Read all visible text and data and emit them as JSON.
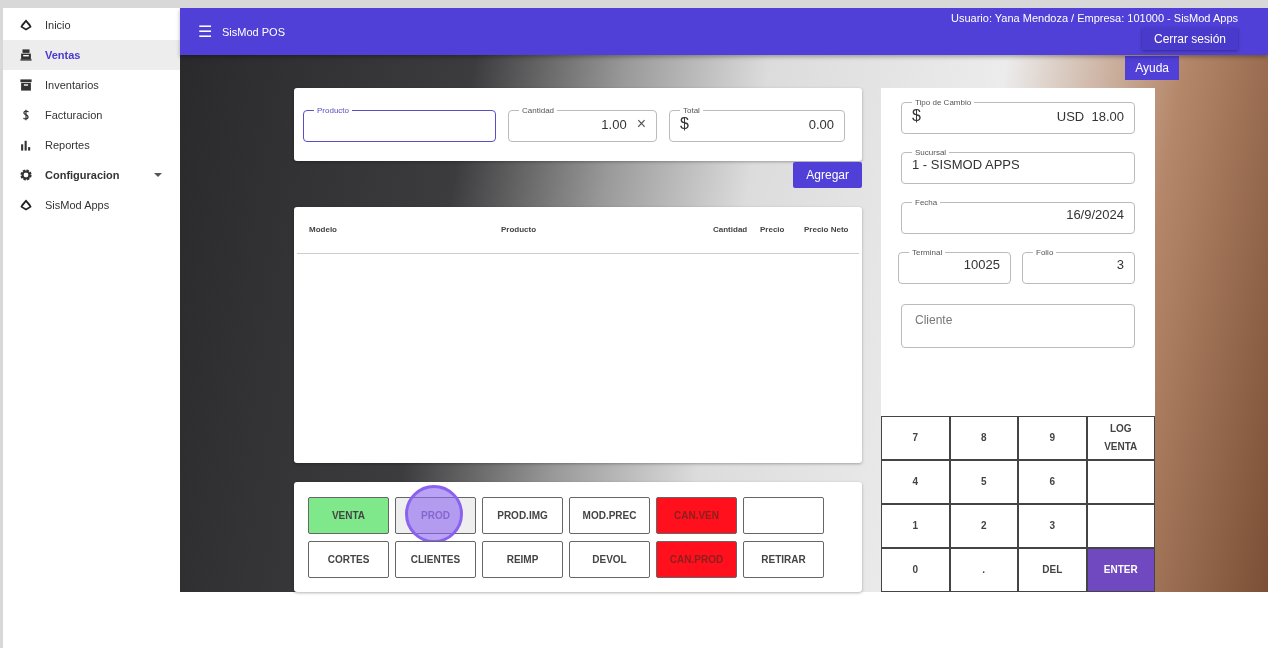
{
  "sidebar": {
    "items": [
      {
        "label": "Inicio",
        "selected": false,
        "expandable": false
      },
      {
        "label": "Ventas",
        "selected": true,
        "expandable": false
      },
      {
        "label": "Inventarios",
        "selected": false,
        "expandable": false
      },
      {
        "label": "Facturacion",
        "selected": false,
        "expandable": false
      },
      {
        "label": "Reportes",
        "selected": false,
        "expandable": false
      },
      {
        "label": "Configuracion",
        "selected": false,
        "expandable": true
      },
      {
        "label": "SisMod Apps",
        "selected": false,
        "expandable": false
      }
    ]
  },
  "app_bar": {
    "menu_icon": "☰",
    "title": "SisMod POS",
    "user_info": "Usuario: Yana Mendoza / Empresa: 101000 - SisMod Apps",
    "logout_button": "Cerrar sesión",
    "help_button": "Ayuda"
  },
  "entry": {
    "producto": {
      "label": "Producto",
      "focused": true
    },
    "cantidad": {
      "label": "Cantidad",
      "value": "1.00",
      "clear": "×"
    },
    "total": {
      "label": "Total",
      "prefix": "$",
      "value": "0.00"
    },
    "add_button": "Agregar"
  },
  "table": {
    "columns": [
      "Modelo",
      "Producto",
      "Cantidad",
      "Precio",
      "Precio Neto"
    ]
  },
  "functions": [
    {
      "label": "VENTA",
      "kind": "success",
      "pressed": false
    },
    {
      "label": "PROD",
      "kind": "plain",
      "pressed": true
    },
    {
      "label": "PROD.IMG",
      "kind": "plain",
      "pressed": false
    },
    {
      "label": "MOD.PREC",
      "kind": "plain",
      "pressed": false
    },
    {
      "label": "CAN.VEN",
      "kind": "danger",
      "pressed": false
    },
    {
      "kind": "plain",
      "pressed": false
    },
    {
      "label": "CORTES",
      "kind": "plain",
      "pressed": false
    },
    {
      "label": "CLIENTES",
      "kind": "plain",
      "pressed": false
    },
    {
      "label": "REIMP",
      "kind": "plain",
      "pressed": false
    },
    {
      "label": "DEVOL",
      "kind": "plain",
      "pressed": false
    },
    {
      "label": "CAN.PROD",
      "kind": "danger",
      "pressed": false
    },
    {
      "label": "RETIRAR",
      "kind": "plain",
      "pressed": false
    }
  ],
  "details": {
    "tipo_cambio": {
      "label": "Tipo de Cambio",
      "prefix": "$",
      "value": "USD  18.00"
    },
    "sucursal": {
      "label": "Sucursal",
      "value": "1 - SISMOD APPS"
    },
    "fecha": {
      "label": "Fecha",
      "value": "16/9/2024"
    },
    "terminal": {
      "label": "Terminal",
      "value": "10025"
    },
    "folio": {
      "label": "Folio",
      "value": "3"
    },
    "cliente": {
      "placeholder": "Cliente"
    }
  },
  "keypad": [
    {
      "label": "7",
      "kind": "plain"
    },
    {
      "label": "8",
      "kind": "plain"
    },
    {
      "label": "9",
      "kind": "plain"
    },
    {
      "label": "LOG VENTA",
      "kind": "plain"
    },
    {
      "label": "4",
      "kind": "plain"
    },
    {
      "label": "5",
      "kind": "plain"
    },
    {
      "label": "6",
      "kind": "plain"
    },
    {
      "kind": "plain"
    },
    {
      "label": "1",
      "kind": "plain"
    },
    {
      "label": "2",
      "kind": "plain"
    },
    {
      "label": "3",
      "kind": "plain"
    },
    {
      "kind": "plain"
    },
    {
      "label": "0",
      "kind": "plain"
    },
    {
      "label": ".",
      "kind": "plain"
    },
    {
      "label": "DEL",
      "kind": "plain"
    },
    {
      "label": "ENTER",
      "kind": "primary"
    }
  ]
}
